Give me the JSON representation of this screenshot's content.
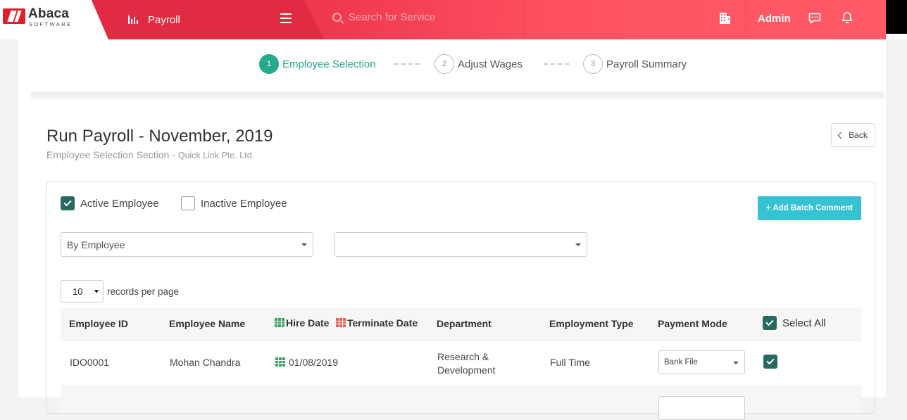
{
  "app": {
    "logo_name": "Abaca",
    "logo_sub": "SOFTWARE",
    "nav_module": "Payroll",
    "search_placeholder": "Search for Service",
    "user": "Admin"
  },
  "stepper": [
    {
      "num": "1",
      "label": "Employee Selection",
      "active": true
    },
    {
      "num": "2",
      "label": "Adjust Wages",
      "active": false
    },
    {
      "num": "3",
      "label": "Payroll Summary",
      "active": false
    }
  ],
  "page": {
    "title": "Run Payroll - November, 2019",
    "subtitle": "Employee Selection Section - ",
    "company": "Quick Link Pte. Ltd.",
    "back_label": "Back"
  },
  "filters": {
    "active_label": "Active Employee",
    "active_checked": true,
    "inactive_label": "Inactive Employee",
    "inactive_checked": false,
    "batch_comment_label": "+ Add Batch Comment",
    "group_by_value": "By Employee",
    "second_select_value": ""
  },
  "pagination": {
    "records_value": "10",
    "records_label": "records per page"
  },
  "table": {
    "headers": {
      "employee_id": "Employee ID",
      "employee_name": "Employee Name",
      "hire_date": "Hire Date",
      "terminate_date": "Terminate Date",
      "department": "Department",
      "employment_type": "Employment Type",
      "payment_mode": "Payment Mode",
      "select_all": "Select All"
    },
    "rows": [
      {
        "employee_id": "IDO0001",
        "employee_name": "Mohan Chandra",
        "hire_date": "01/08/2019",
        "department_line1": "Research &",
        "department_line2": "Development",
        "employment_type": "Full Time",
        "payment_mode": "Bank File",
        "selected": true
      }
    ]
  },
  "colors": {
    "brand_red": "#e02b42",
    "accent_green": "#26a98d",
    "checkbox_dark": "#27695f",
    "batch_button": "#35c2d3"
  }
}
